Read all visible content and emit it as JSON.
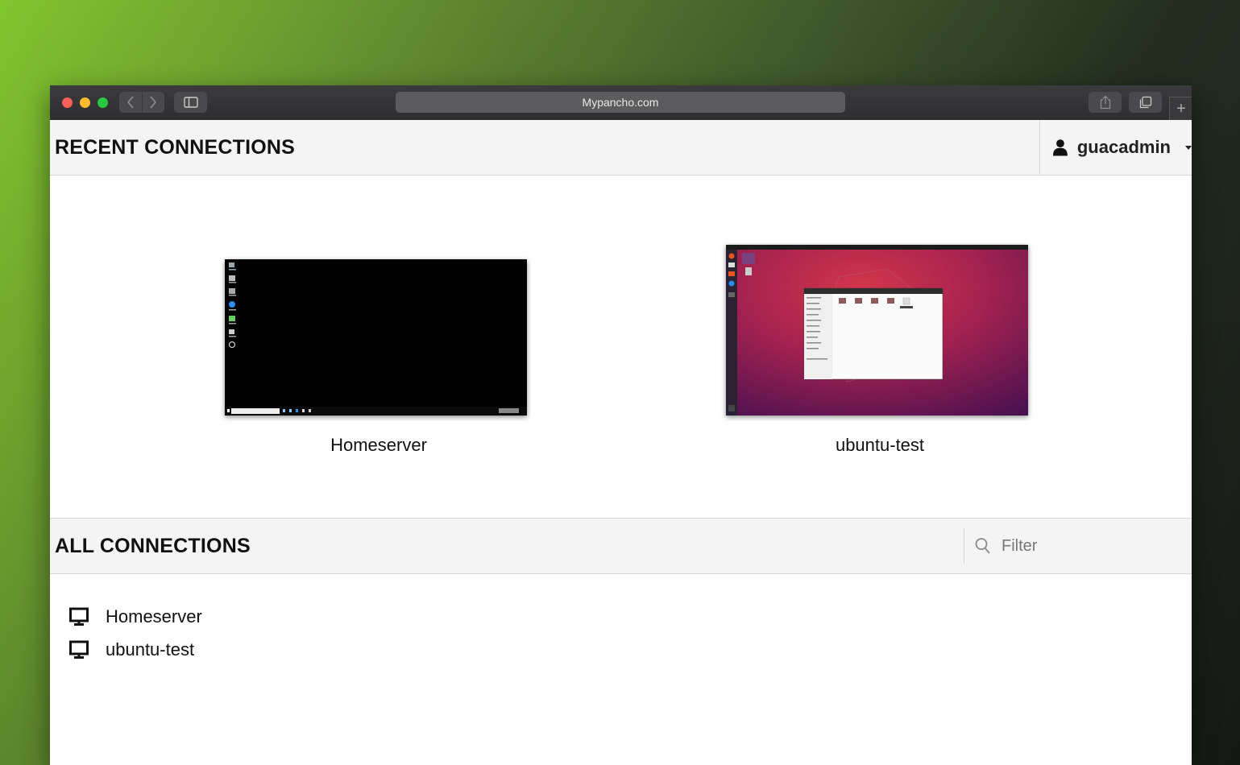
{
  "browser": {
    "url": "Mypancho.com"
  },
  "recent": {
    "title": "RECENT CONNECTIONS",
    "items": [
      {
        "label": "Homeserver"
      },
      {
        "label": "ubuntu-test"
      }
    ]
  },
  "user": {
    "name": "guacadmin"
  },
  "all": {
    "title": "ALL CONNECTIONS",
    "filter_placeholder": "Filter",
    "items": [
      {
        "label": "Homeserver",
        "icon": "monitor-icon"
      },
      {
        "label": "ubuntu-test",
        "icon": "monitor-icon"
      }
    ]
  },
  "colors": {
    "traffic_red": "#fe5f57",
    "traffic_yellow": "#febc2e",
    "traffic_green": "#28c840",
    "header_bg": "#f4f4f4"
  }
}
